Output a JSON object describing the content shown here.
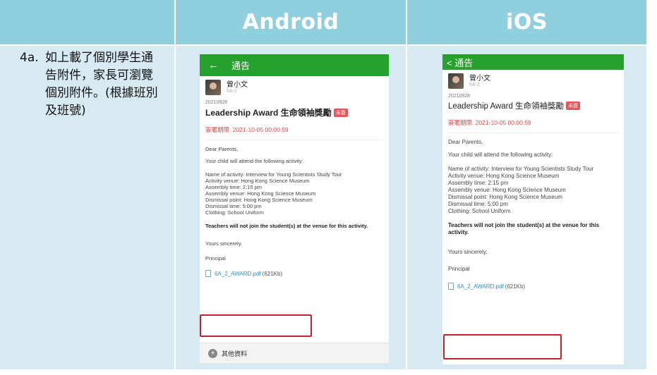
{
  "header": {
    "android": "Android",
    "ios": "iOS"
  },
  "step": {
    "number": "4a.",
    "text": "如上載了個別學生通告附件，家長可瀏覽個別附件。(根據班別及班號)"
  },
  "notice": {
    "bar_title": "通告",
    "ios_back": "< 通告",
    "sender_name": "曾小文",
    "sender_class": "6A-2",
    "date": "20210928",
    "title": "Leadership Award 生命領袖獎勵",
    "tag": "未簽",
    "deadline": "簽署期限: 2021-10-05 00:00:59",
    "greeting": "Dear Parents,",
    "intro": "Your child will attend the following activity:",
    "activity_name": "Name of activity: Interview for Young Scientists Study Tour",
    "venue": "Activity venue: Hong Kong Science Museum",
    "assembly_time": "Assembly time: 2:15 pm",
    "assembly_venue": "Assembly venue: Hong Kong Science Museum",
    "dismissal_point": "Dismissal point: Hong Kong Science Museum",
    "dismissal_time": "Dismissal time: 5:00 pm",
    "clothing": "Clothing: School Uniform",
    "note": "Teachers will not join the student(s) at the venue for this activity.",
    "closing": "Yours sincerely,",
    "signature": "Principal",
    "attachment_name": "6A_2_AWARD.pdf",
    "attachment_size": "(621Kb)",
    "more_label": "其他資料"
  },
  "colors": {
    "header_bg": "#8fcfde",
    "cell_bg": "#d7e9f1",
    "app_green": "#27a12e",
    "highlight": "#c8202b"
  }
}
